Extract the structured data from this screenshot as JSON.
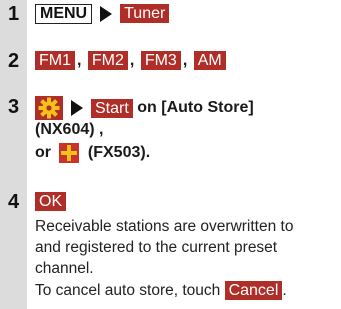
{
  "steps": [
    {
      "number": "1",
      "menu_key": "MENU",
      "target_key": "Tuner"
    },
    {
      "number": "2",
      "bands": [
        "FM1",
        "FM2",
        "FM3",
        "AM"
      ],
      "separator": ","
    },
    {
      "number": "3",
      "icon": "gear-icon",
      "start_key": "Start",
      "line1_text": "on [Auto Store]",
      "line2_text": "(NX604) ,",
      "line3_prefix": "or",
      "alt_icon": "plus-icon",
      "line3_suffix": "(FX503)."
    },
    {
      "number": "4",
      "ok_key": "OK",
      "desc_lines": [
        "Receivable stations are overwritten to",
        "and registered to the current preset",
        "channel."
      ],
      "cancel_prefix": "To cancel auto store, touch",
      "cancel_key": "Cancel",
      "cancel_suffix": "."
    }
  ],
  "colors": {
    "key_bg": "#b02e28",
    "number_bar": "#dcdcdc",
    "icon_yellow": "#f2c11a",
    "icon_red": "#c8342b"
  }
}
